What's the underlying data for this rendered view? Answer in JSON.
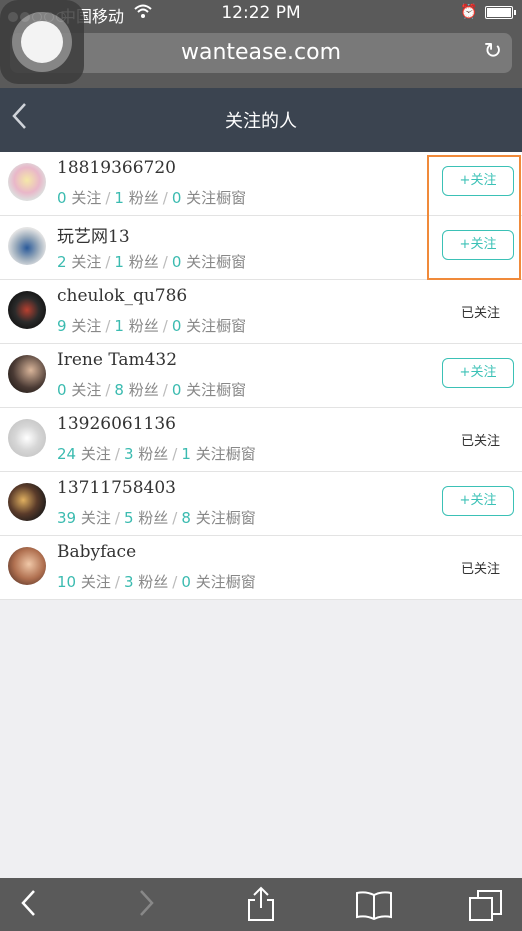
{
  "status": {
    "carrier": "中国移动",
    "time": "12:22 PM"
  },
  "browser": {
    "url": "wantease.com"
  },
  "nav": {
    "title": "关注的人",
    "back_icon": "chevron-left-icon"
  },
  "labels": {
    "follow_word": "关注",
    "fans_word": "粉丝",
    "window_word": "关注橱窗",
    "follow_button": "+关注",
    "followed_text": "已关注"
  },
  "colors": {
    "accent": "#3bc1b6",
    "highlight": "#f08a3a",
    "navbar": "#3b4450"
  },
  "users": [
    {
      "name": "18819366720",
      "following": "0",
      "fans": "1",
      "windows": "0",
      "state": "follow"
    },
    {
      "name": "玩艺网13",
      "following": "2",
      "fans": "1",
      "windows": "0",
      "state": "follow"
    },
    {
      "name": "cheulok_qu786",
      "following": "9",
      "fans": "1",
      "windows": "0",
      "state": "followed"
    },
    {
      "name": "Irene Tam432",
      "following": "0",
      "fans": "8",
      "windows": "0",
      "state": "follow"
    },
    {
      "name": "13926061136",
      "following": "24",
      "fans": "3",
      "windows": "1",
      "state": "followed"
    },
    {
      "name": "13711758403",
      "following": "39",
      "fans": "5",
      "windows": "8",
      "state": "follow"
    },
    {
      "name": "Babyface",
      "following": "10",
      "fans": "3",
      "windows": "0",
      "state": "followed"
    }
  ]
}
